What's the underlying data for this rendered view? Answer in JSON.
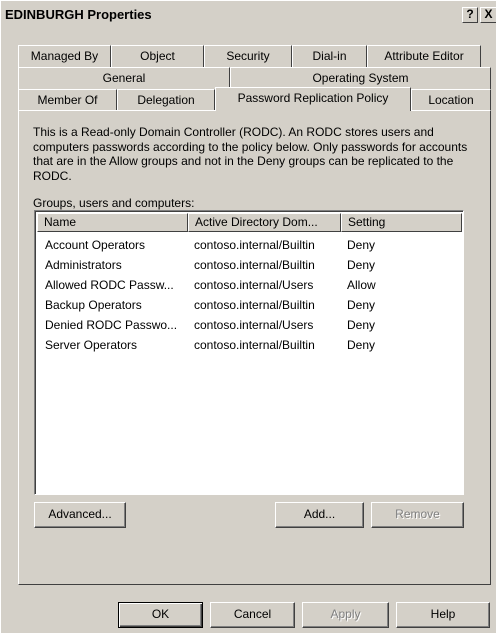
{
  "window": {
    "title": "EDINBURGH Properties",
    "help_label": "?",
    "close_label": "X"
  },
  "tabs": {
    "row1": [
      "Managed By",
      "Object",
      "Security",
      "Dial-in",
      "Attribute Editor"
    ],
    "row2": [
      "General",
      "Operating System"
    ],
    "row3": [
      "Member Of",
      "Delegation",
      "Password Replication Policy",
      "Location"
    ],
    "active": "Password Replication Policy"
  },
  "panel": {
    "description": "This is a Read-only Domain Controller (RODC).  An RODC stores users and computers passwords according to the policy below.  Only passwords for accounts that are in the Allow groups and not in the Deny groups can be replicated to the RODC.",
    "list_label": "Groups, users and computers:",
    "columns": [
      "Name",
      "Active Directory Dom...",
      "Setting"
    ],
    "rows": [
      {
        "name": "Account Operators",
        "domain": "contoso.internal/Builtin",
        "setting": "Deny"
      },
      {
        "name": "Administrators",
        "domain": "contoso.internal/Builtin",
        "setting": "Deny"
      },
      {
        "name": "Allowed RODC Passw...",
        "domain": "contoso.internal/Users",
        "setting": "Allow"
      },
      {
        "name": "Backup Operators",
        "domain": "contoso.internal/Builtin",
        "setting": "Deny"
      },
      {
        "name": "Denied RODC Passwo...",
        "domain": "contoso.internal/Users",
        "setting": "Deny"
      },
      {
        "name": "Server Operators",
        "domain": "contoso.internal/Builtin",
        "setting": "Deny"
      }
    ],
    "advanced_label": "Advanced...",
    "add_label": "Add...",
    "remove_label": "Remove"
  },
  "footer": {
    "ok_label": "OK",
    "cancel_label": "Cancel",
    "apply_label": "Apply",
    "help_label": "Help"
  }
}
